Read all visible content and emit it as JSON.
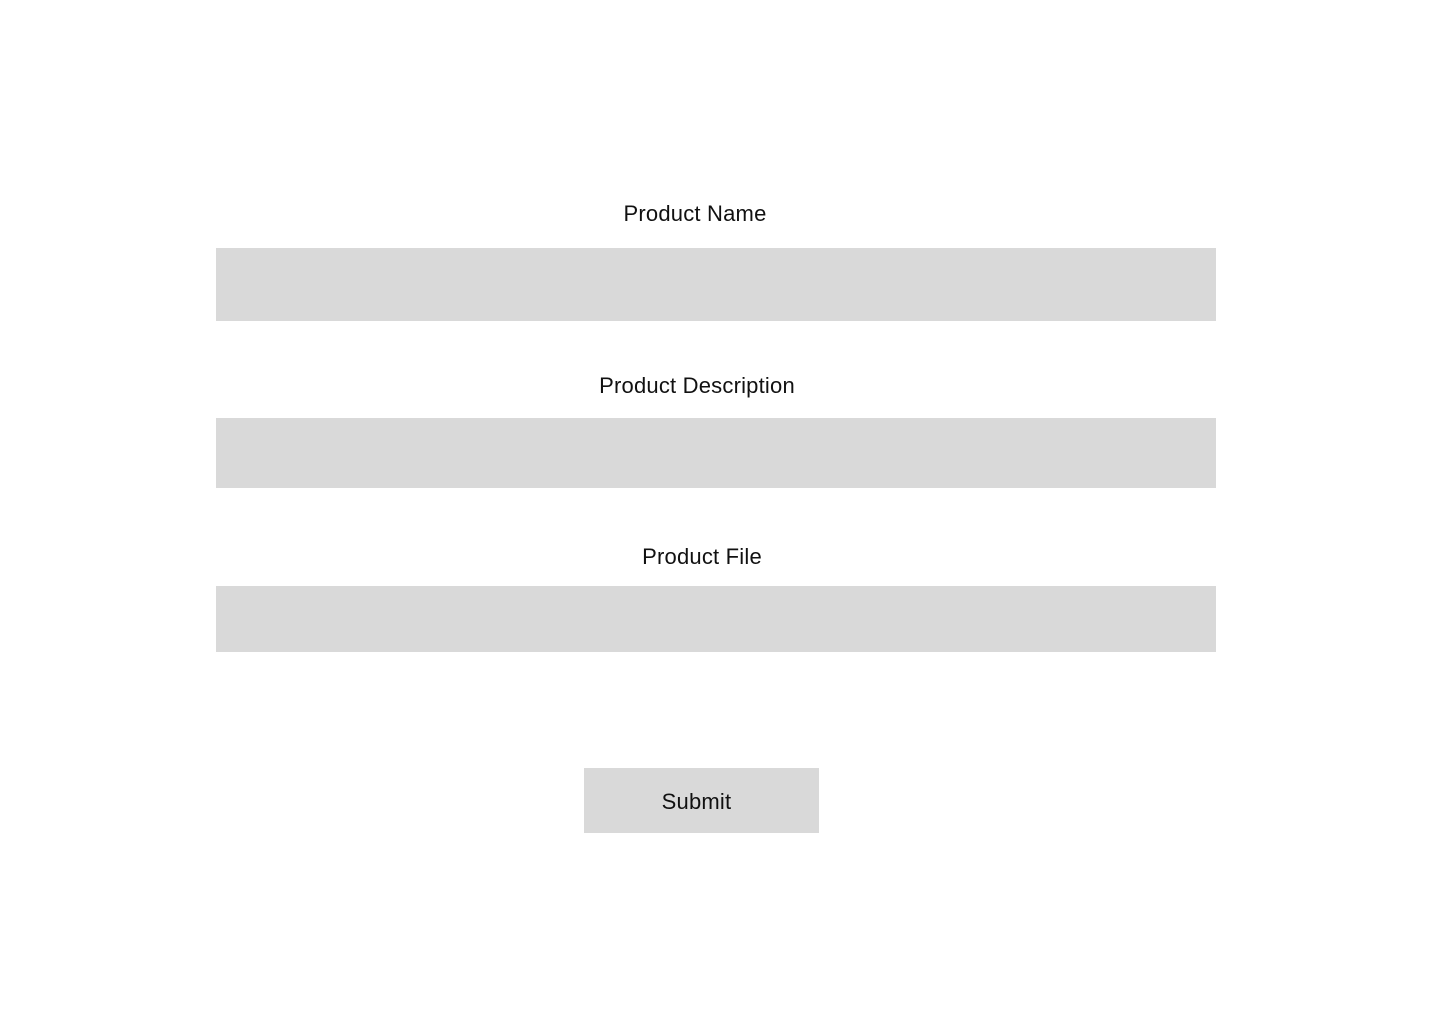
{
  "form": {
    "fields": [
      {
        "label": "Product Name",
        "value": "",
        "placeholder": ""
      },
      {
        "label": "Product Description",
        "value": "",
        "placeholder": ""
      },
      {
        "label": "Product File",
        "value": "",
        "placeholder": ""
      }
    ],
    "submit_label": "Submit"
  },
  "colors": {
    "background": "#ffffff",
    "field_fill": "#d9d9d9",
    "text": "#111111"
  }
}
